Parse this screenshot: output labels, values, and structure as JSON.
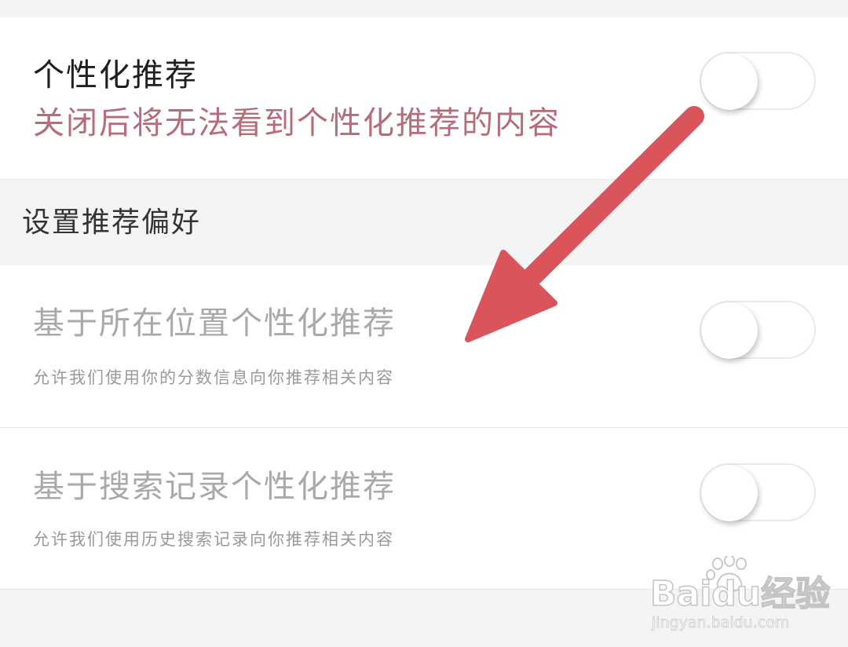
{
  "personal_recommendation": {
    "title": "个性化推荐",
    "warning": "关闭后将无法看到个性化推荐的内容",
    "toggle_on": false
  },
  "preferences_section": {
    "header": "设置推荐偏好",
    "items": [
      {
        "title": "基于所在位置个性化推荐",
        "description": "允许我们使用你的分数信息向你推荐相关内容",
        "toggle_on": false,
        "disabled": true
      },
      {
        "title": "基于搜索记录个性化推荐",
        "description": "允许我们使用历史搜索记录向你推荐相关内容",
        "toggle_on": false,
        "disabled": true
      }
    ]
  },
  "annotation": {
    "arrow_color": "#d9545b",
    "icon": "arrow-icon"
  },
  "watermark": {
    "brand": "Baidu经验",
    "domain": "jingyan.baidu.com",
    "icon": "paw-icon"
  },
  "colors": {
    "warning_text": "#b56e79",
    "disabled_text": "#a9a9a9",
    "background": "#f4f4f4"
  }
}
